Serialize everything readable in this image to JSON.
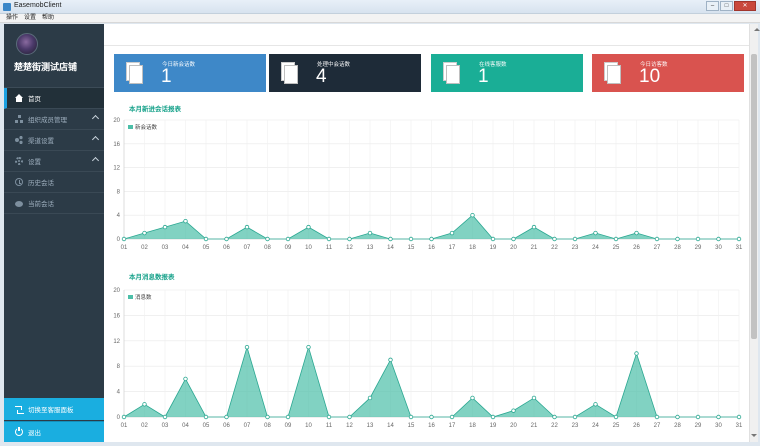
{
  "window": {
    "title": "EasemobClient",
    "controls": [
      "–",
      "□",
      "✕"
    ]
  },
  "menubar": [
    "操作",
    "设置",
    "帮助"
  ],
  "sidebar": {
    "store_name": "楚楚街测试店铺",
    "items": [
      {
        "label": "首页",
        "icon": "home-icon",
        "active": true,
        "expandable": false
      },
      {
        "label": "组织成员管理",
        "icon": "org-icon",
        "active": false,
        "expandable": true
      },
      {
        "label": "渠道设置",
        "icon": "share-icon",
        "active": false,
        "expandable": true
      },
      {
        "label": "设置",
        "icon": "gear-icon",
        "active": false,
        "expandable": true
      },
      {
        "label": "历史会话",
        "icon": "clock-icon",
        "active": false,
        "expandable": false
      },
      {
        "label": "当前会话",
        "icon": "chat-icon",
        "active": false,
        "expandable": false
      }
    ],
    "switch_label": "切换至客服面板",
    "logout_label": "退出"
  },
  "stats": [
    {
      "label": "今日新会话数",
      "value": "1",
      "color": "#3e88c8"
    },
    {
      "label": "处理中会话数",
      "value": "4",
      "color": "#1e2b38"
    },
    {
      "label": "在线客服数",
      "value": "1",
      "color": "#1aae96"
    },
    {
      "label": "今日访客数",
      "value": "10",
      "color": "#d9534f"
    }
  ],
  "charts": {
    "sessions_title": "本月新进会话报表",
    "messages_title": "本月消息数报表"
  },
  "chart_data": [
    {
      "type": "area",
      "title": "本月新进会话报表",
      "x": [
        "01",
        "02",
        "03",
        "04",
        "05",
        "06",
        "07",
        "08",
        "09",
        "10",
        "11",
        "12",
        "13",
        "14",
        "15",
        "16",
        "17",
        "18",
        "19",
        "20",
        "21",
        "22",
        "23",
        "24",
        "25",
        "26",
        "27",
        "28",
        "29",
        "30",
        "31"
      ],
      "series": [
        {
          "name": "新会话数",
          "values": [
            0,
            1,
            2,
            3,
            0,
            0,
            2,
            0,
            0,
            2,
            0,
            0,
            1,
            0,
            0,
            0,
            1,
            4,
            0,
            0,
            2,
            0,
            0,
            1,
            0,
            1,
            0,
            0,
            0,
            0,
            0
          ],
          "color": "#4cbfa8"
        }
      ],
      "yticks": [
        0,
        4,
        8,
        12,
        16,
        20
      ],
      "ylim": [
        0,
        20
      ],
      "grid": true,
      "legend": "top-left"
    },
    {
      "type": "area",
      "title": "本月消息数报表",
      "x": [
        "01",
        "02",
        "03",
        "04",
        "05",
        "06",
        "07",
        "08",
        "09",
        "10",
        "11",
        "12",
        "13",
        "14",
        "15",
        "16",
        "17",
        "18",
        "19",
        "20",
        "21",
        "22",
        "23",
        "24",
        "25",
        "26",
        "27",
        "28",
        "29",
        "30",
        "31"
      ],
      "series": [
        {
          "name": "消息数",
          "values": [
            0,
            2,
            0,
            6,
            0,
            0,
            11,
            0,
            0,
            11,
            0,
            0,
            3,
            9,
            0,
            0,
            0,
            3,
            0,
            1,
            3,
            0,
            0,
            2,
            0,
            10,
            0,
            0,
            0,
            0,
            0
          ],
          "color": "#4cbfa8"
        }
      ],
      "yticks": [
        0,
        4,
        8,
        12,
        16,
        20
      ],
      "ylim": [
        0,
        20
      ],
      "grid": true,
      "legend": "top-left"
    }
  ]
}
